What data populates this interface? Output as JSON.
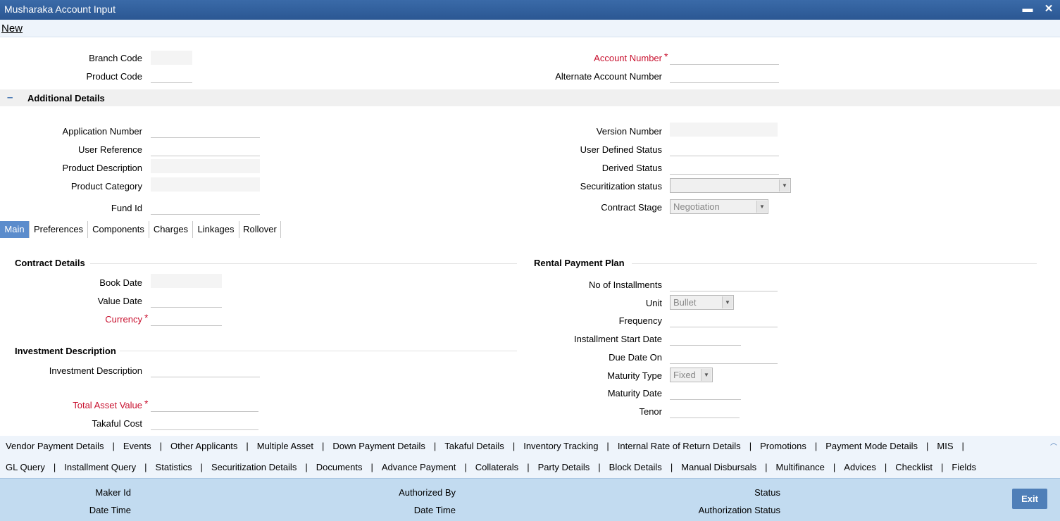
{
  "window": {
    "title": "Musharaka Account Input",
    "minimize_glyph": "▬",
    "close_glyph": "✕"
  },
  "toolbar": {
    "new_label": "New"
  },
  "header_fields": {
    "branch_code": "Branch Code",
    "product_code": "Product Code",
    "account_number": "Account Number",
    "alternate_account_number": "Alternate Account Number"
  },
  "additional": {
    "title": "Additional Details",
    "collapse_glyph": "–",
    "application_number": "Application Number",
    "user_reference": "User Reference",
    "product_description": "Product Description",
    "product_category": "Product Category",
    "fund_id": "Fund Id",
    "version_number": "Version Number",
    "user_defined_status": "User Defined Status",
    "derived_status": "Derived Status",
    "securitization_status": "Securitization status",
    "securitization_value": "",
    "contract_stage": "Contract Stage",
    "contract_stage_value": "Negotiation"
  },
  "tabs": [
    "Main",
    "Preferences",
    "Components",
    "Charges",
    "Linkages",
    "Rollover"
  ],
  "contract": {
    "title": "Contract Details",
    "book_date": "Book Date",
    "value_date": "Value Date",
    "currency": "Currency"
  },
  "investment": {
    "title": "Investment Description",
    "description": "Investment Description",
    "total_asset_value": "Total Asset Value",
    "takaful_cost": "Takaful Cost"
  },
  "rental": {
    "title": "Rental Payment Plan",
    "no_installments": "No of Installments",
    "unit": "Unit",
    "unit_value": "Bullet",
    "frequency": "Frequency",
    "installment_start_date": "Installment Start Date",
    "due_date_on": "Due Date On",
    "maturity_type": "Maturity Type",
    "maturity_type_value": "Fixed",
    "maturity_date": "Maturity Date",
    "tenor": "Tenor"
  },
  "links_row1": [
    "Vendor Payment Details",
    "Events",
    "Other Applicants",
    "Multiple Asset",
    "Down Payment Details",
    "Takaful Details",
    "Inventory Tracking",
    "Internal Rate of Return Details",
    "Promotions",
    "Payment Mode Details",
    "MIS"
  ],
  "links_row2": [
    "GL Query",
    "Installment Query",
    "Statistics",
    "Securitization Details",
    "Documents",
    "Advance Payment",
    "Collaterals",
    "Party Details",
    "Block Details",
    "Manual Disbursals",
    "Multifinance",
    "Advices",
    "Checklist",
    "Fields"
  ],
  "footer": {
    "maker_id": "Maker Id",
    "date_time": "Date Time",
    "authorized_by": "Authorized By",
    "date_time_2": "Date Time",
    "status": "Status",
    "authorization_status": "Authorization Status",
    "exit_label": "Exit"
  },
  "colors": {
    "titlebar": "#2b5793",
    "required": "#c8102e",
    "active_tab": "#5b8ccc",
    "footer": "#c2dbf0"
  }
}
